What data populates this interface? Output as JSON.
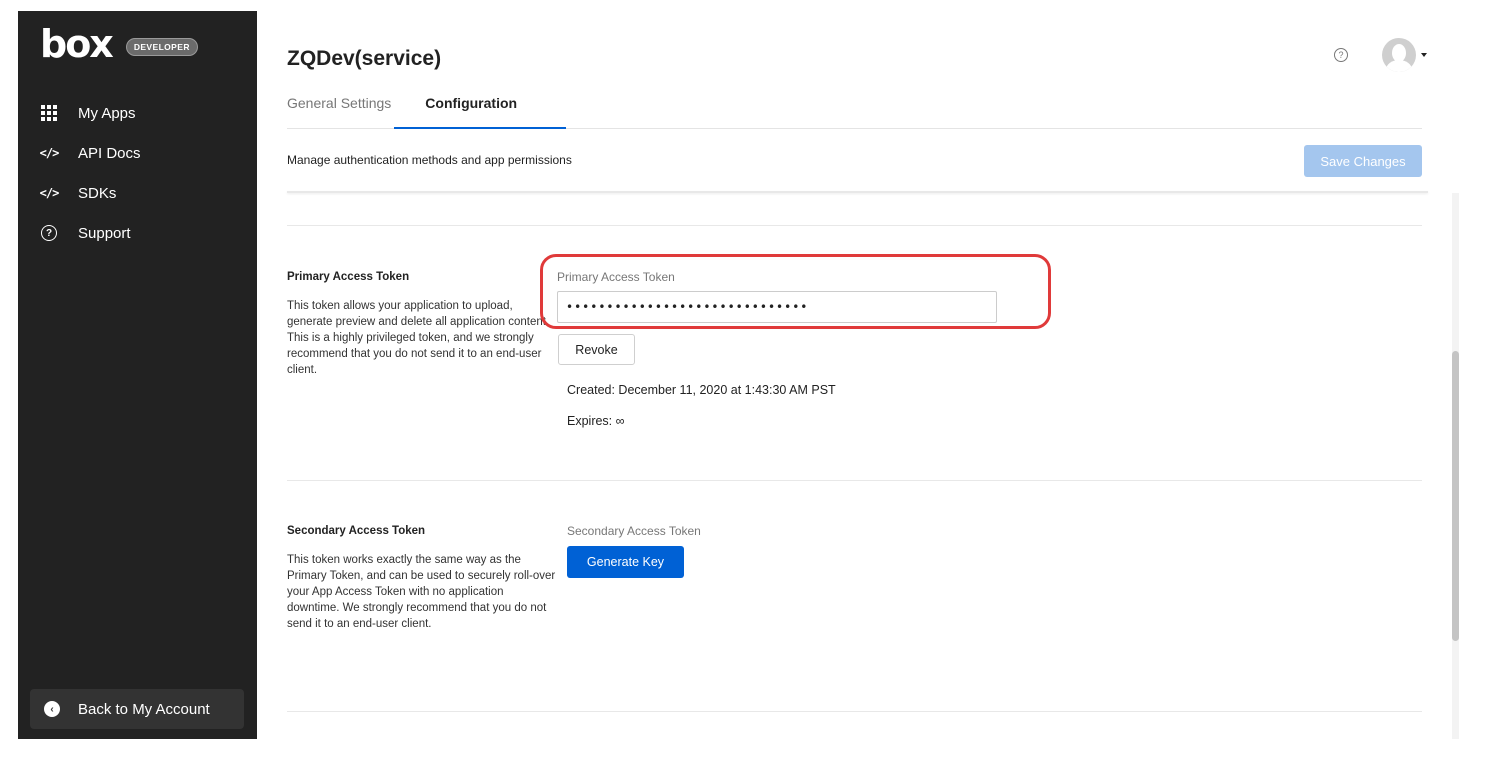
{
  "sidebar": {
    "logo": "box",
    "badge": "DEVELOPER",
    "items": [
      {
        "label": "My Apps",
        "icon": "grid-icon"
      },
      {
        "label": "API Docs",
        "icon": "code-icon"
      },
      {
        "label": "SDKs",
        "icon": "code-icon"
      },
      {
        "label": "Support",
        "icon": "help-circle-icon"
      }
    ],
    "back_label": "Back to My Account"
  },
  "header": {
    "title": "ZQDev(service)",
    "help_icon": "?",
    "tabs": [
      {
        "label": "General Settings",
        "active": false
      },
      {
        "label": "Configuration",
        "active": true
      }
    ],
    "subtitle": "Manage authentication methods and app permissions",
    "save_label": "Save Changes"
  },
  "primary": {
    "title": "Primary Access Token",
    "description": "This token allows your application to upload, generate preview and delete all application content. This is a highly privileged token, and we strongly recommend that you do not send it to an end-user client.",
    "field_label": "Primary Access Token",
    "token_value": "••••••••••••••••••••••••••••••",
    "revoke_label": "Revoke",
    "created": "Created: December 11, 2020 at 1:43:30 AM PST",
    "expires": "Expires: ∞"
  },
  "secondary": {
    "title": "Secondary Access Token",
    "description": "This token works exactly the same way as the Primary Token, and can be used to securely roll-over your App Access Token with no application downtime. We strongly recommend that you do not send it to an end-user client.",
    "field_label": "Secondary Access Token",
    "generate_label": "Generate Key"
  },
  "colors": {
    "sidebar_bg": "#222222",
    "accent": "#0061d5",
    "save_disabled": "#a4c6ee",
    "highlight": "#e03a3a"
  }
}
